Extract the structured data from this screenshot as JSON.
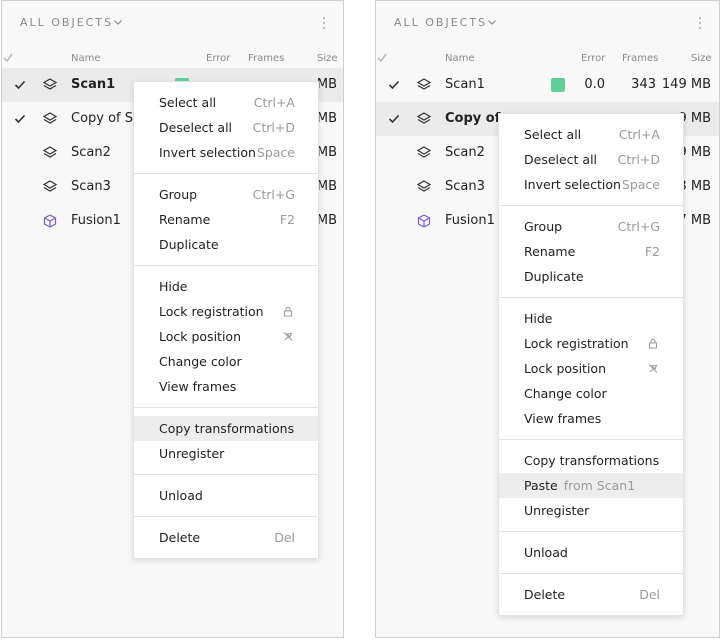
{
  "left": {
    "header": "ALL OBJECTS",
    "columns": {
      "name": "Name",
      "error": "Error",
      "frames": "Frames",
      "size": "Size"
    },
    "rows": [
      {
        "name": "Scan1",
        "checked": true,
        "bold": true,
        "swatch": true,
        "size": "MB"
      },
      {
        "name": "Copy of Sc",
        "checked": true,
        "size": "MB"
      },
      {
        "name": "Scan2",
        "size": "MB"
      },
      {
        "name": "Scan3",
        "size": "MB"
      },
      {
        "name": "Fusion1",
        "size": "MB"
      }
    ],
    "menu": {
      "select_all": "Select all",
      "select_all_sc": "Ctrl+A",
      "deselect_all": "Deselect all",
      "deselect_all_sc": "Ctrl+D",
      "invert_selection": "Invert selection",
      "invert_selection_sc": "Space",
      "group": "Group",
      "group_sc": "Ctrl+G",
      "rename": "Rename",
      "rename_sc": "F2",
      "duplicate": "Duplicate",
      "hide": "Hide",
      "lock_registration": "Lock registration",
      "lock_position": "Lock position",
      "change_color": "Change color",
      "view_frames": "View frames",
      "copy_transformations": "Copy transformations",
      "unregister": "Unregister",
      "unload": "Unload",
      "delete": "Delete",
      "delete_sc": "Del"
    }
  },
  "right": {
    "header": "ALL OBJECTS",
    "columns": {
      "name": "Name",
      "error": "Error",
      "frames": "Frames",
      "size": "Size"
    },
    "rows": [
      {
        "name": "Scan1",
        "checked": true,
        "swatch": true,
        "error": "0.0",
        "frames": "343",
        "size": "149 MB"
      },
      {
        "name": "Copy of .",
        "checked": true,
        "bold": true,
        "size": "9 MB"
      },
      {
        "name": "Scan2",
        "size": "9 MB"
      },
      {
        "name": "Scan3",
        "size": "3 MB"
      },
      {
        "name": "Fusion1",
        "size": "7 MB"
      }
    ],
    "menu": {
      "select_all": "Select all",
      "select_all_sc": "Ctrl+A",
      "deselect_all": "Deselect all",
      "deselect_all_sc": "Ctrl+D",
      "invert_selection": "Invert selection",
      "invert_selection_sc": "Space",
      "group": "Group",
      "group_sc": "Ctrl+G",
      "rename": "Rename",
      "rename_sc": "F2",
      "duplicate": "Duplicate",
      "hide": "Hide",
      "lock_registration": "Lock registration",
      "lock_position": "Lock position",
      "change_color": "Change color",
      "view_frames": "View frames",
      "copy_transformations": "Copy transformations",
      "paste": "Paste",
      "paste_from": "from Scan1",
      "unregister": "Unregister",
      "unload": "Unload",
      "delete": "Delete",
      "delete_sc": "Del"
    }
  },
  "colors": {
    "swatch": "#5fcf96",
    "fusion_icon": "#7b5cd6",
    "highlight": "#ededed",
    "selected_row": "#ebebeb"
  },
  "icons": {
    "check": "check-icon",
    "scan": "layers-icon",
    "fusion": "cube-icon",
    "lock": "lock-icon",
    "pin": "pin-off-icon",
    "menu": "kebab-icon",
    "chevron": "chevron-down-icon"
  }
}
